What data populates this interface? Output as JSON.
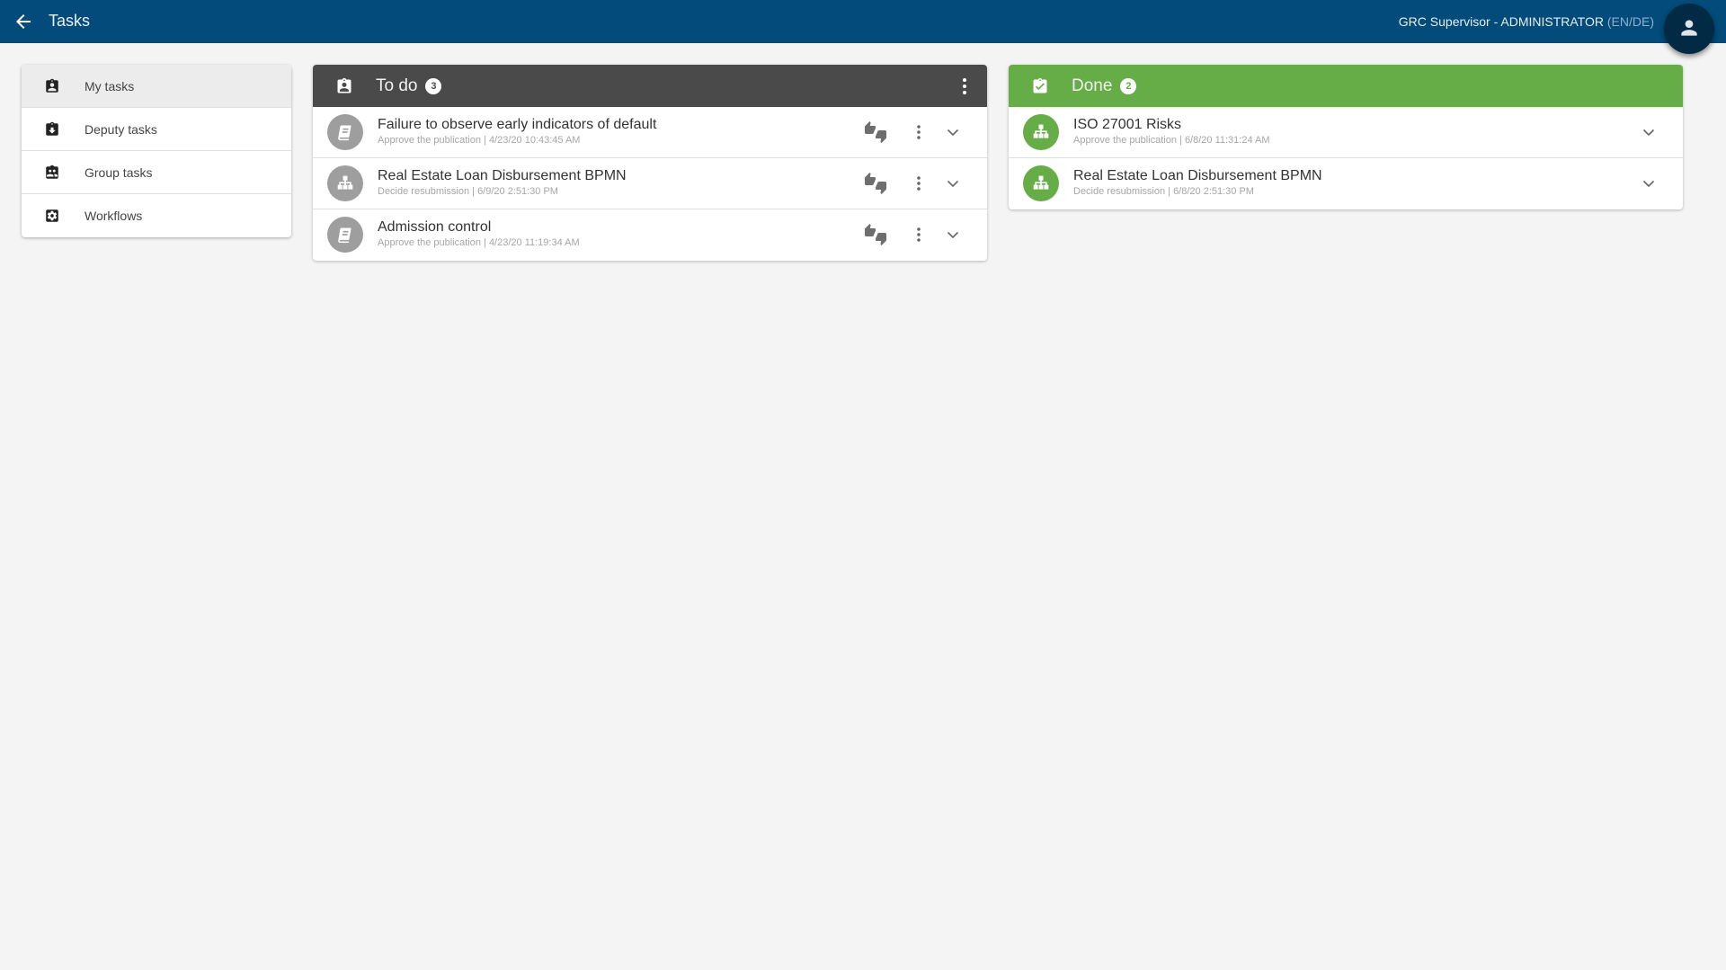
{
  "header": {
    "back_icon": "arrow-left-icon",
    "title": "Tasks",
    "user_name": "GRC Supervisor - ADMINISTRATOR",
    "language": "(EN/DE)",
    "avatar_icon": "person-icon",
    "bg_color": "#024b7a"
  },
  "sidebar": {
    "items": [
      {
        "label": "My tasks",
        "icon": "clipboard-account-icon",
        "active": true
      },
      {
        "label": "Deputy tasks",
        "icon": "clipboard-arrow-down-icon",
        "active": false
      },
      {
        "label": "Group tasks",
        "icon": "clipboard-group-icon",
        "active": false
      },
      {
        "label": "Workflows",
        "icon": "cog-box-icon",
        "active": false
      }
    ]
  },
  "todo": {
    "title": "To do",
    "count": "3",
    "color": "#4a4a4a",
    "items": [
      {
        "title": "Failure to observe early indicators of default",
        "subtitle": "Approve the publication | 4/23/20 10:43:45 AM",
        "icon": "book-icon"
      },
      {
        "title": "Real Estate Loan Disbursement BPMN",
        "subtitle": "Decide resubmission | 6/9/20 2:51:30 PM",
        "icon": "sitemap-icon"
      },
      {
        "title": "Admission control",
        "subtitle": "Approve the publication | 4/23/20 11:19:34 AM",
        "icon": "book-icon"
      }
    ]
  },
  "done": {
    "title": "Done",
    "count": "2",
    "color": "#66ad47",
    "items": [
      {
        "title": "ISO 27001 Risks",
        "subtitle": "Approve the publication | 6/8/20 11:31:24 AM",
        "icon": "sitemap-icon"
      },
      {
        "title": "Real Estate Loan Disbursement BPMN",
        "subtitle": "Decide resubmission | 6/8/20 2:51:30 PM",
        "icon": "sitemap-icon"
      }
    ]
  }
}
